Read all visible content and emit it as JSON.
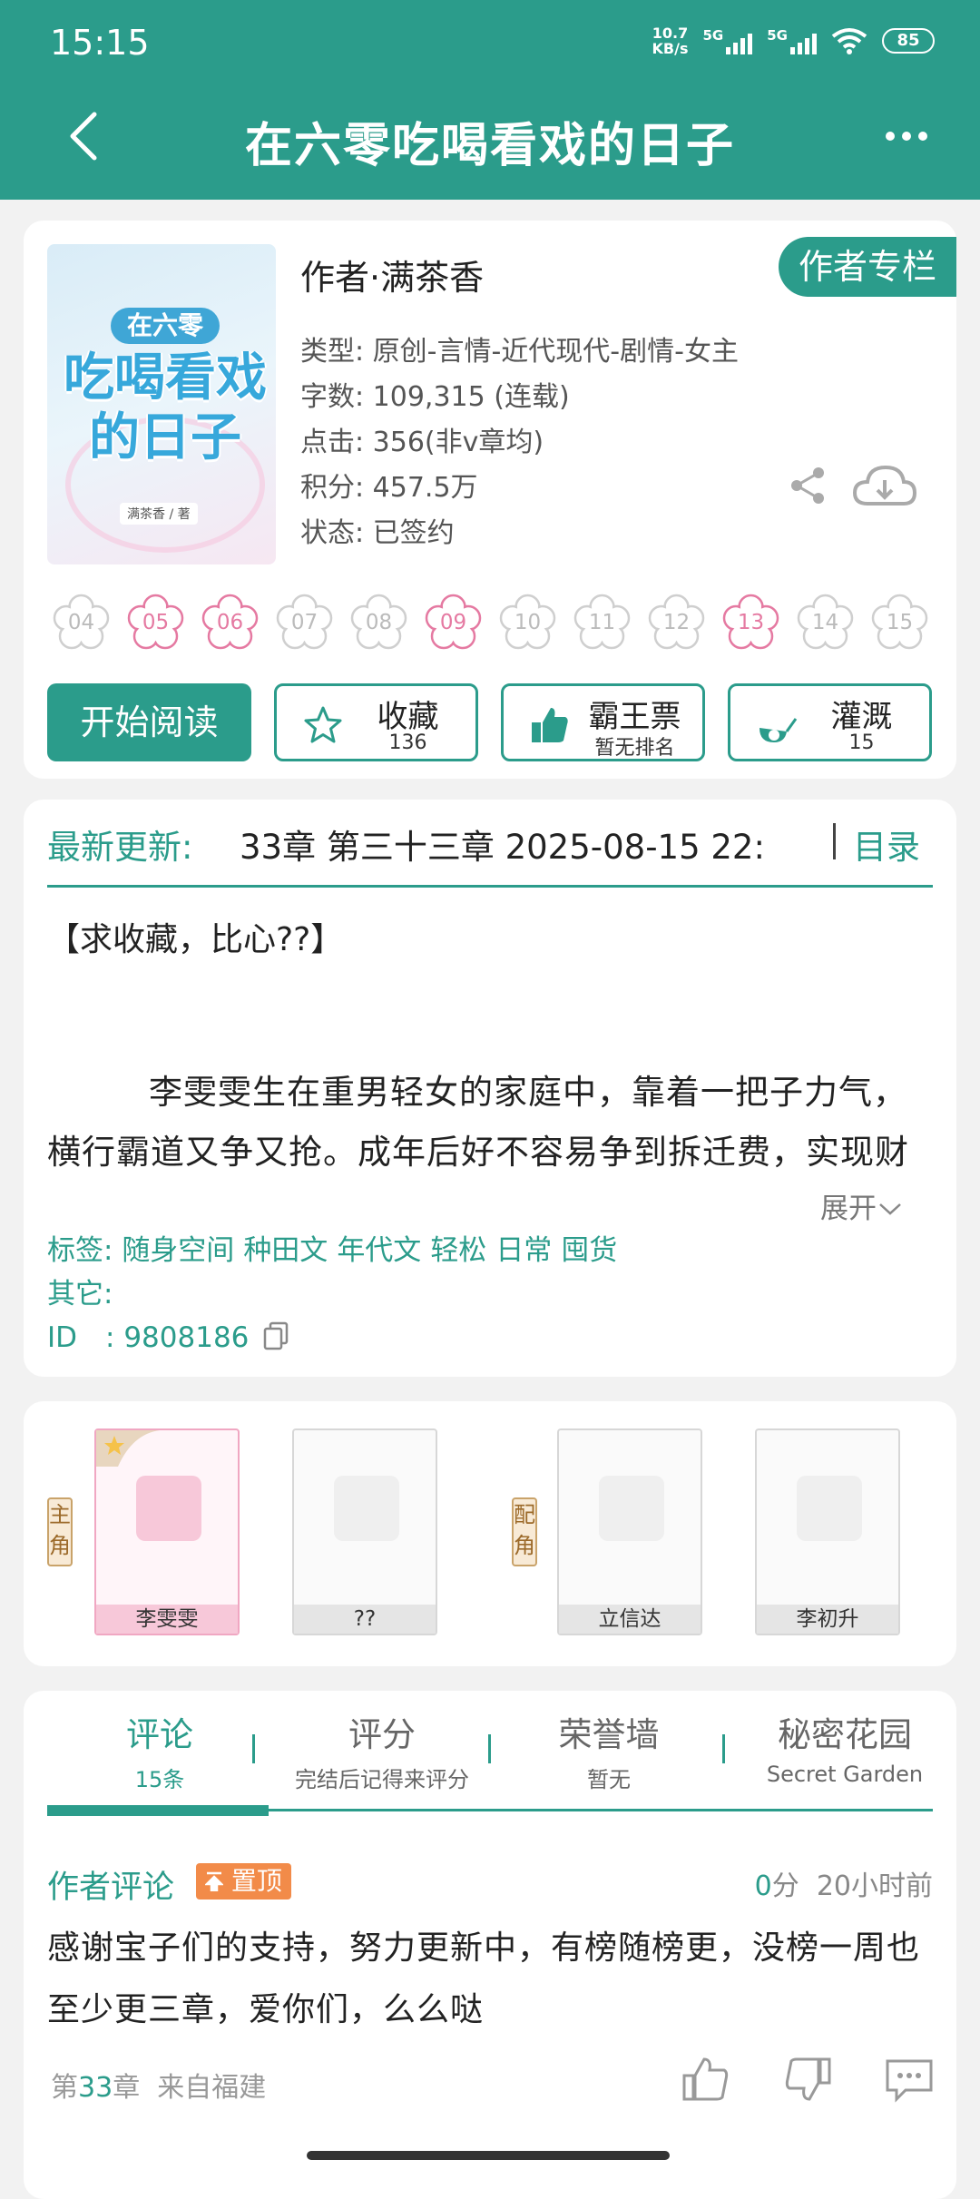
{
  "status": {
    "time": "15:15",
    "net_speed_top": "10.7",
    "net_speed_bottom": "KB/s",
    "signal1": "5G",
    "signal2": "5G",
    "battery": "85"
  },
  "header": {
    "title": "在六零吃喝看戏的日子",
    "back_icon": "back-arrow-icon",
    "more_icon": "more-dots-icon"
  },
  "book": {
    "cover_badge": "在六零",
    "cover_title": "吃喝看戏的日子",
    "cover_author": "满茶香 / 著",
    "author": "作者·满茶香",
    "column_button": "作者专栏",
    "meta": [
      "类型: 原创-言情-近代现代-剧情-女主",
      "字数: 109,315 (连载)",
      "点击: 356(非v章均)",
      "积分: 457.5万",
      "状态: 已签约"
    ],
    "flowers": [
      {
        "label": "04",
        "on": false
      },
      {
        "label": "05",
        "on": true
      },
      {
        "label": "06",
        "on": true
      },
      {
        "label": "07",
        "on": false
      },
      {
        "label": "08",
        "on": false
      },
      {
        "label": "09",
        "on": true
      },
      {
        "label": "10",
        "on": false
      },
      {
        "label": "11",
        "on": false
      },
      {
        "label": "12",
        "on": false
      },
      {
        "label": "13",
        "on": true
      },
      {
        "label": "14",
        "on": false
      },
      {
        "label": "15",
        "on": false
      }
    ]
  },
  "actions": {
    "read": "开始阅读",
    "fav": {
      "label": "收藏",
      "sub": "136"
    },
    "ticket": {
      "label": "霸王票",
      "sub": "暂无排名"
    },
    "water": {
      "label": "灌溉",
      "sub": "15"
    }
  },
  "update": {
    "label": "最新更新:",
    "text": "33章  第三十三章  2025-08-15 22:",
    "toc": "目录",
    "intro_title": "【求收藏，比心??】",
    "intro_body": "李雯雯生在重男轻女的家庭中，靠着一把子力气，横行霸道又争又抢。成年后好不容易争到拆迁费，实现财",
    "expand": "展开",
    "tags_label": "标签:",
    "tags": [
      "随身空间",
      "种田文",
      "年代文",
      "轻松",
      "日常",
      "囤货"
    ],
    "other_label": "其它:",
    "id_label": "ID　:",
    "id_value": "9808186"
  },
  "roles": {
    "main_tag": "主角",
    "support_tag": "配角",
    "main": [
      "李雯雯",
      "??"
    ],
    "support": [
      "立信达",
      "李初升"
    ]
  },
  "tabs": [
    {
      "title": "评论",
      "sub": "15条"
    },
    {
      "title": "评分",
      "sub": "完结后记得来评分"
    },
    {
      "title": "荣誉墙",
      "sub": "暂无"
    },
    {
      "title": "秘密花园",
      "sub": "Secret Garden"
    }
  ],
  "comment": {
    "head": "作者评论",
    "pin": "置顶",
    "score": "0",
    "score_unit": "分",
    "time": "20小时前",
    "body": "感谢宝子们的支持，努力更新中，有榜随榜更，没榜一周也至少更三章，爱你们，么么哒",
    "chapter_prefix": "第",
    "chapter_num": "33",
    "chapter_suffix": "章",
    "from": "来自福建"
  },
  "colors": {
    "primary": "#2b9c8b",
    "flower_on": "#e57aa2",
    "pin": "#f28b49"
  }
}
